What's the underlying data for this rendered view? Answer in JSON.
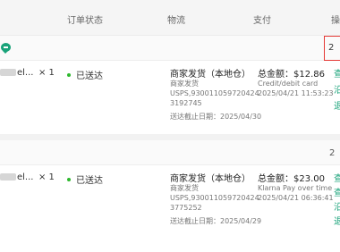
{
  "table_header": {
    "status": "订单状态",
    "logistics": "物流",
    "payment": "支付",
    "actions": "操"
  },
  "orders": [
    {
      "header_value": "2",
      "product_name_suffix": "el...",
      "quantity": "× 1",
      "status": "已送达",
      "status_color": "#2eb82e",
      "logistics_title": "商家发货（本地仓）",
      "logistics_label": "商家发货",
      "tracking_line1": "USPS,930011059720424",
      "tracking_line2": "3192745",
      "delivery_deadline": "送达截止日期：2025/04/30",
      "total_label": "总金额：",
      "total_amount": "$12.86",
      "payment_method": "Credit/debit card",
      "payment_time": "2025/04/21 11:53:23",
      "action_links": [
        "查",
        "沿",
        "退"
      ]
    },
    {
      "header_value": "2",
      "product_name_suffix": "el...",
      "quantity": "× 1",
      "status": "已送达",
      "status_color": "#2eb82e",
      "logistics_title": "商家发货（本地仓）",
      "logistics_label": "商家发货",
      "tracking_line1": "USPS,930011059720424",
      "tracking_line2": "3775252",
      "delivery_deadline": "送达截止日期：2025/04/29",
      "total_label": "总金额：",
      "total_amount": "$23.00",
      "payment_method": "Klarna Pay over time",
      "payment_time": "2025/04/21 06:36:41",
      "action_links": [
        "查",
        "查",
        "沿",
        "退"
      ]
    }
  ],
  "colors": {
    "accent": "#1aa37a",
    "highlight_border": "#e53935"
  }
}
